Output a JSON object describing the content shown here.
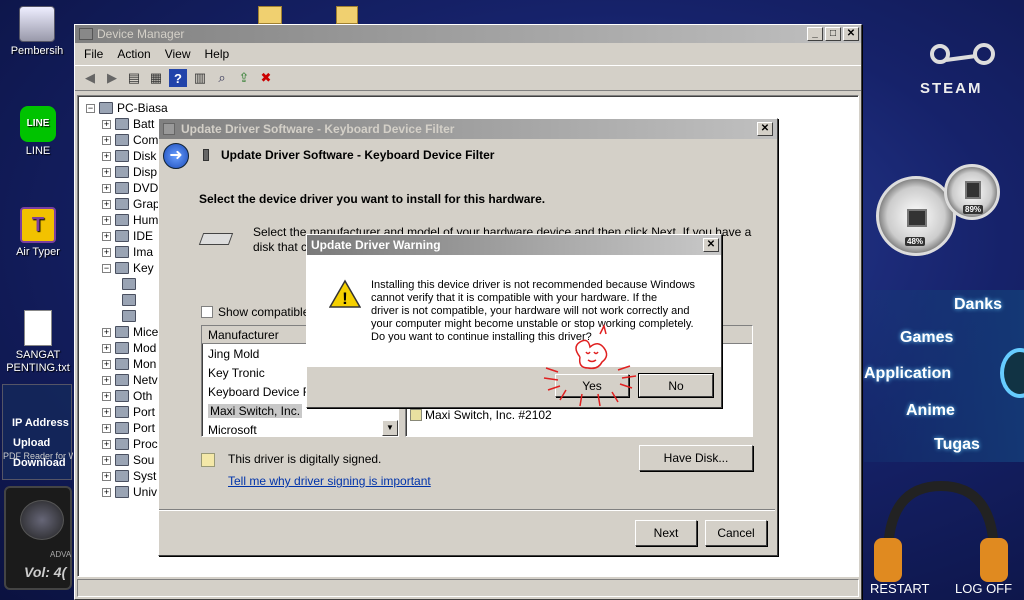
{
  "desktop": {
    "icons": [
      {
        "label": "Pembersih"
      },
      {
        "label": "LINE"
      },
      {
        "label": "Air Typer"
      },
      {
        "label": "SANGAT PENTING.txt"
      }
    ],
    "ip_widget": {
      "ip": "IP Address",
      "upload": "Upload",
      "download": "Download",
      "pdf": "PDF Reader for Windows"
    },
    "vol_widget": {
      "brand": "ADVA",
      "vol": "Vol: 4("
    }
  },
  "gadgets": {
    "steam": "STEAM",
    "cpu_percent": "48%",
    "mem_percent": "89%",
    "menu": [
      "Danks",
      "Games",
      "Application",
      "Anime",
      "Tugas"
    ],
    "restart": "RESTART",
    "logoff": "LOG OFF"
  },
  "device_manager": {
    "title": "Device Manager",
    "menu": [
      "File",
      "Action",
      "View",
      "Help"
    ],
    "root": "PC-Biasa",
    "tree": [
      "Batt",
      "Com",
      "Disk",
      "Disp",
      "DVD",
      "Grap",
      "Hum",
      "IDE",
      "Ima",
      "Key",
      "",
      "",
      "",
      "Mice",
      "Mod",
      "Mon",
      "Netv",
      "Oth",
      "Port",
      "Port",
      "Proc",
      "Sou",
      "Syst",
      "Univ"
    ]
  },
  "update_driver": {
    "window_title": "Update Driver Software - Keyboard Device Filter",
    "header": "Update Driver Software - Keyboard Device Filter",
    "instruction": "Select the device driver you want to install for this hardware.",
    "desc_line1": "Select the manufacturer and model of your hardware device and then click Next. If you have a",
    "desc_line2": "disk that c",
    "show_compatible": "Show compatible",
    "manufacturer_header": "Manufacturer",
    "manufacturers": [
      "Jing Mold",
      "Key Tronic",
      "Keyboard Device Fi",
      "Maxi Switch, Inc.",
      "Microsoft"
    ],
    "model_item": "Maxi Switch, Inc. #2102",
    "signed_text": "This driver is digitally signed.",
    "signing_link": "Tell me why driver signing is important",
    "have_disk": "Have Disk...",
    "next": "Next",
    "cancel": "Cancel"
  },
  "warning": {
    "title": "Update Driver Warning",
    "lines": [
      "Installing this device driver is not recommended because Windows",
      "cannot verify that it is compatible with your hardware.  If the",
      "driver is not compatible, your hardware will not work correctly and",
      "your computer might become unstable or stop working completely.",
      "Do you want to continue installing this driver?"
    ],
    "yes": "Yes",
    "no": "No"
  }
}
